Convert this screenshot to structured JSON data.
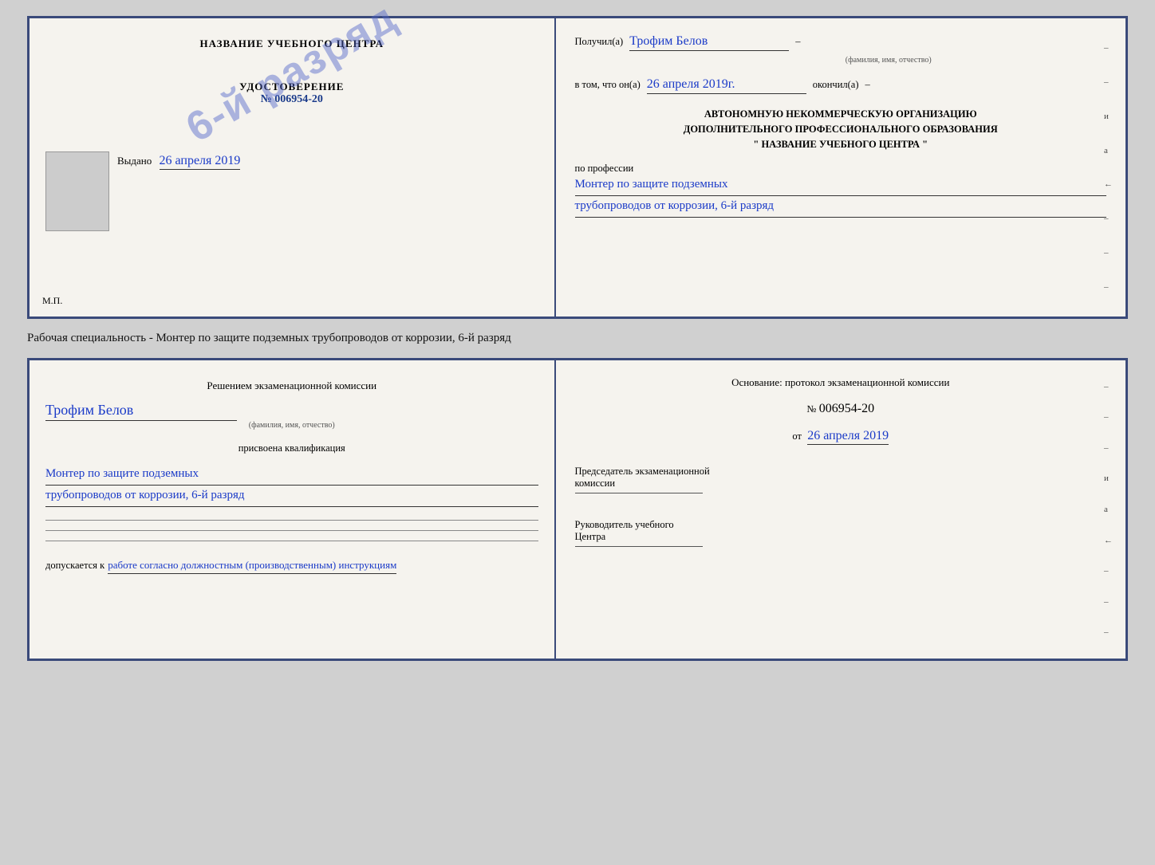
{
  "top_cert": {
    "left": {
      "title": "НАЗВАНИЕ УЧЕБНОГО ЦЕНТРА",
      "cert_label": "УДОСТОВЕРЕНИЕ",
      "cert_number": "№ 006954-20",
      "stamp_text": "6-й разряд",
      "issued_label": "Выдано",
      "issued_date": "26 апреля 2019",
      "mp_label": "М.П."
    },
    "right": {
      "received_label": "Получил(а)",
      "name_handwritten": "Трофим Белов",
      "name_subtext": "(фамилия, имя, отчество)",
      "dash1": "–",
      "in_that_label": "в том, что он(а)",
      "date_handwritten": "26 апреля 2019г.",
      "finished_label": "окончил(а)",
      "dash2": "–",
      "org_line1": "АВТОНОМНУЮ НЕКОММЕРЧЕСКУЮ ОРГАНИЗАЦИЮ",
      "org_line2": "ДОПОЛНИТЕЛЬНОГО ПРОФЕССИОНАЛЬНОГО ОБРАЗОВАНИЯ",
      "org_line3": "\"  НАЗВАНИЕ УЧЕБНОГО ЦЕНТРА  \"",
      "dash3": "–",
      "by_profession_label": "по профессии",
      "profession_line1": "Монтер по защите подземных",
      "profession_line2": "трубопроводов от коррозии, 6-й разряд"
    }
  },
  "between_text": "Рабочая специальность - Монтер по защите подземных трубопроводов от коррозии, 6-й разряд",
  "bottom_cert": {
    "left": {
      "decision_label": "Решением экзаменационной комиссии",
      "name_handwritten": "Трофим Белов",
      "name_subtext": "(фамилия, имя, отчество)",
      "qualification_label": "присвоена квалификация",
      "qualification_line1": "Монтер по защите подземных",
      "qualification_line2": "трубопроводов от коррозии, 6-й разряд",
      "allowed_label": "допускается к",
      "allowed_handwritten": "работе согласно должностным (производственным) инструкциям"
    },
    "right": {
      "basis_label": "Основание: протокол экзаменационной  комиссии",
      "doc_number_prefix": "№",
      "doc_number": "006954-20",
      "from_prefix": "от",
      "from_date": "26 апреля 2019",
      "dash1": "–",
      "chairman_line1": "Председатель экзаменационной",
      "chairman_line2": "комиссии",
      "head_line1": "Руководитель учебного",
      "head_line2": "Центра"
    }
  }
}
